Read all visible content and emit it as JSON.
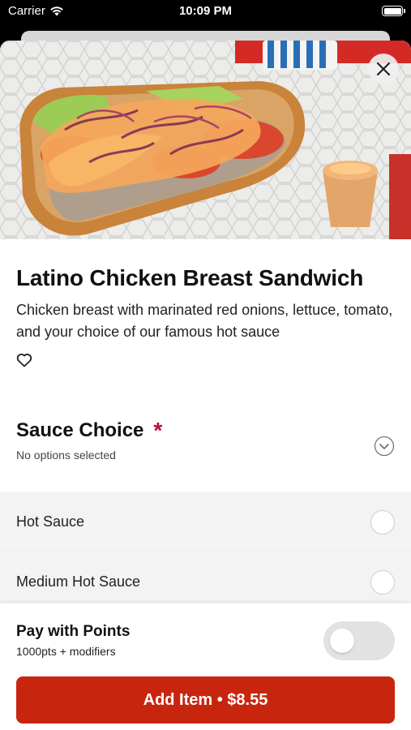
{
  "status_bar": {
    "carrier": "Carrier",
    "time": "10:09 PM"
  },
  "item": {
    "title": "Latino Chicken Breast Sandwich",
    "description": "Chicken breast with marinated red onions, lettuce, tomato, and your choice of our famous hot sauce"
  },
  "sauce": {
    "title": "Sauce Choice",
    "required_mark": "*",
    "subtitle": "No options selected",
    "options": [
      {
        "label": "Hot Sauce",
        "selected": false
      },
      {
        "label": "Medium Hot Sauce",
        "selected": false
      }
    ]
  },
  "footer": {
    "points_title": "Pay with Points",
    "points_sub": "1000pts + modifiers",
    "points_enabled": false,
    "add_button": "Add Item • $8.55"
  },
  "colors": {
    "accent": "#c8250f",
    "required": "#b3103a"
  },
  "icons": [
    "wifi-icon",
    "battery-icon",
    "close-icon",
    "heart-icon",
    "chevron-down-circle-icon",
    "radio-icon"
  ]
}
